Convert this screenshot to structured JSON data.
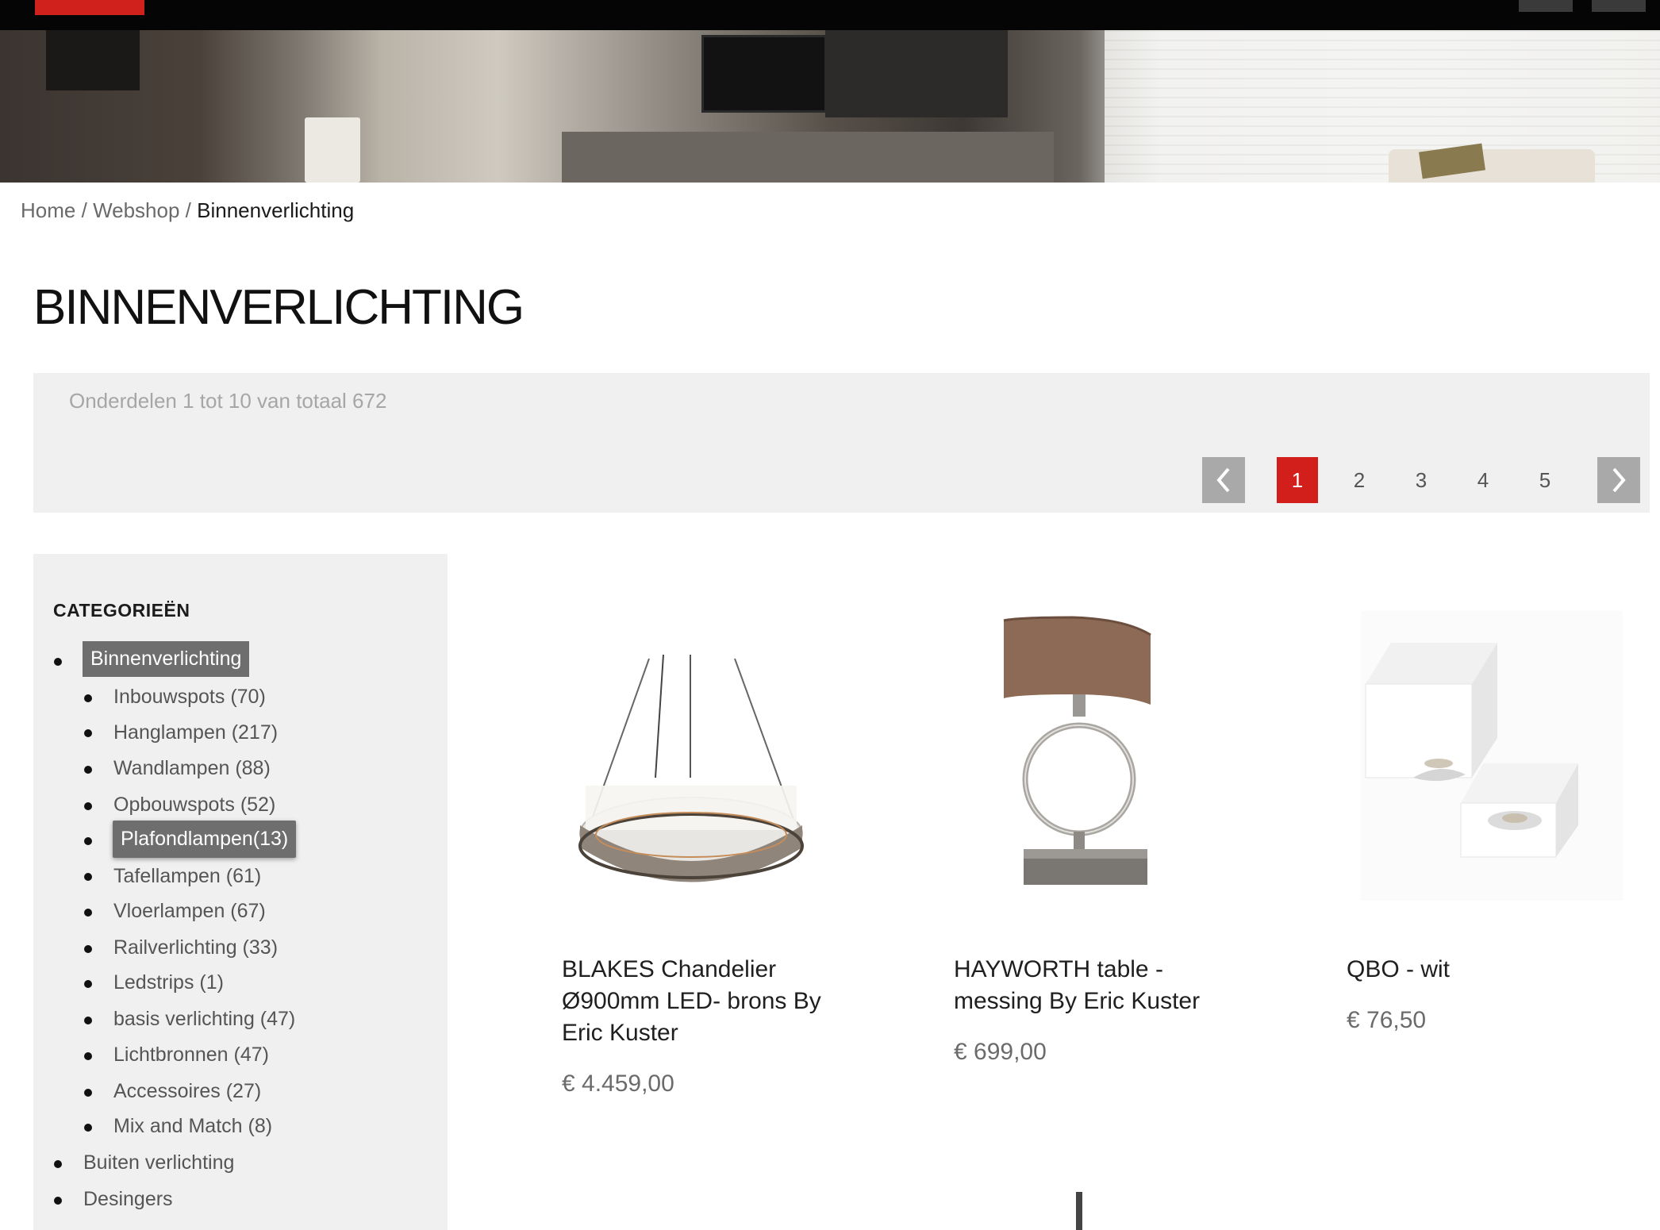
{
  "breadcrumb": {
    "home": "Home",
    "sep": "/",
    "webshop": "Webshop",
    "current": "Binnenverlichting"
  },
  "page_title": "BINNENVERLICHTING",
  "toolbar": {
    "count_text": "Onderdelen 1 tot 10 van totaal 672",
    "pages": [
      "1",
      "2",
      "3",
      "4",
      "5"
    ],
    "active_page": "1",
    "prev_icon": "chevron-left-icon",
    "next_icon": "chevron-right-icon"
  },
  "sidebar": {
    "title": "CATEGORIEËN",
    "active_category": "Binnenverlichting",
    "hover_sub": "Plafondlampen(13)",
    "subcategories": [
      "Inbouwspots (70)",
      "Hanglampen (217)",
      "Wandlampen (88)",
      "Opbouwspots (52)",
      "Plafondlampen(13)",
      "Tafellampen (61)",
      "Vloerlampen (67)",
      "Railverlichting (33)",
      "Ledstrips (1)",
      "basis verlichting (47)",
      "Lichtbronnen (47)",
      "Accessoires (27)",
      "Mix and Match (8)"
    ],
    "other_categories": [
      "Buiten verlichting",
      "Desingers"
    ]
  },
  "products": [
    {
      "name_lines": [
        "BLAKES Chandelier",
        "Ø900mm LED- brons By",
        "Eric Kuster"
      ],
      "price": "€ 4.459,00"
    },
    {
      "name_lines": [
        "HAYWORTH table -",
        "messing By Eric Kuster"
      ],
      "price": "€ 699,00"
    },
    {
      "name_lines": [
        "QBO - wit"
      ],
      "price": "€ 76,50"
    }
  ],
  "colors": {
    "accent_red": "#d21f1c",
    "topbar": "#050505",
    "panel_gray": "#f0f0f0",
    "chip_gray": "#6e6e6e"
  }
}
